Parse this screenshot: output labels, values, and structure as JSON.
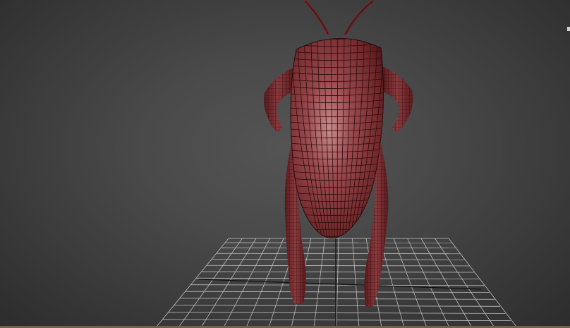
{
  "viewport": {
    "background_top": "#545454",
    "background_bottom": "#2c2c2c",
    "grid_color": "#bdbdbd",
    "axis_color": "#111111",
    "mesh_color": "#7a2e31",
    "mesh_highlight": "#b56a6c",
    "wire_color": "#2a0c0e",
    "status_strip_color": "#6e6448"
  },
  "model": {
    "icon": "cockroach-mesh-icon"
  }
}
